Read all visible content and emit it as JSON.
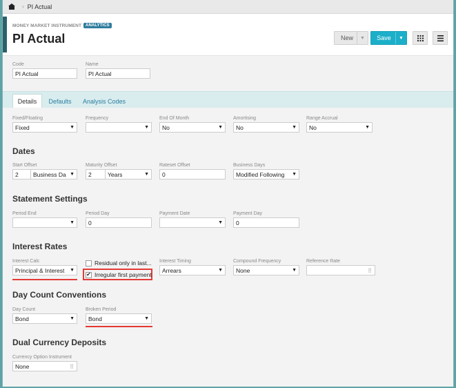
{
  "breadcrumb": {
    "current": "PI Actual"
  },
  "header": {
    "subtitle": "MONEY MARKET INSTRUMENT",
    "badge": "ANALYTICS",
    "title": "PI Actual",
    "new_label": "New",
    "save_label": "Save"
  },
  "code_field": {
    "label": "Code",
    "value": "PI Actual"
  },
  "name_field": {
    "label": "Name",
    "value": "PI Actual"
  },
  "tabs": [
    {
      "label": "Details"
    },
    {
      "label": "Defaults"
    },
    {
      "label": "Analysis Codes"
    }
  ],
  "general": {
    "fixed_floating": {
      "label": "Fixed/Floating",
      "value": "Fixed"
    },
    "frequency": {
      "label": "Frequency",
      "value": ""
    },
    "end_of_month": {
      "label": "End Of Month",
      "value": "No"
    },
    "amortising": {
      "label": "Amortising",
      "value": "No"
    },
    "range_accrual": {
      "label": "Range Accrual",
      "value": "No"
    }
  },
  "dates": {
    "title": "Dates",
    "start_offset": {
      "label": "Start Offset",
      "number": "2",
      "unit": "Business Da"
    },
    "maturity_offset": {
      "label": "Maturity Offset",
      "number": "2",
      "unit": "Years"
    },
    "rateset_offset": {
      "label": "Rateset Offset",
      "value": "0"
    },
    "business_days": {
      "label": "Business Days",
      "value": "Modified Following"
    }
  },
  "statement": {
    "title": "Statement Settings",
    "period_end": {
      "label": "Period End",
      "value": ""
    },
    "period_day": {
      "label": "Period Day",
      "value": "0"
    },
    "payment_date": {
      "label": "Payment Date",
      "value": ""
    },
    "payment_day": {
      "label": "Payment Day",
      "value": "0"
    }
  },
  "interest": {
    "title": "Interest Rates",
    "interest_calc": {
      "label": "Interest Calc",
      "value": "Principal & Interest"
    },
    "residual": {
      "label": "Residual only in last...",
      "checked": false
    },
    "irregular": {
      "label": "Irregular first payment",
      "checked": true
    },
    "interest_timing": {
      "label": "Interest Timing",
      "value": "Arrears"
    },
    "compound_frequency": {
      "label": "Compound Frequency",
      "value": "None"
    },
    "reference_rate": {
      "label": "Reference Rate",
      "value": ""
    }
  },
  "daycount": {
    "title": "Day Count Conventions",
    "day_count": {
      "label": "Day Count",
      "value": "Bond"
    },
    "broken_period": {
      "label": "Broken Period",
      "value": "Bond"
    }
  },
  "dual": {
    "title": "Dual Currency Deposits",
    "currency_option": {
      "label": "Currency Option Instrument",
      "value": "None"
    }
  },
  "colors": {
    "accent": "#1cafc9",
    "header_bar": "#2b5f6b",
    "highlight": "#e53935",
    "badge": "#2e7d9e"
  },
  "icons": {
    "home": "home-icon",
    "grid": "grid-icon",
    "menu": "menu-icon",
    "caret": "chevron-down-icon"
  }
}
